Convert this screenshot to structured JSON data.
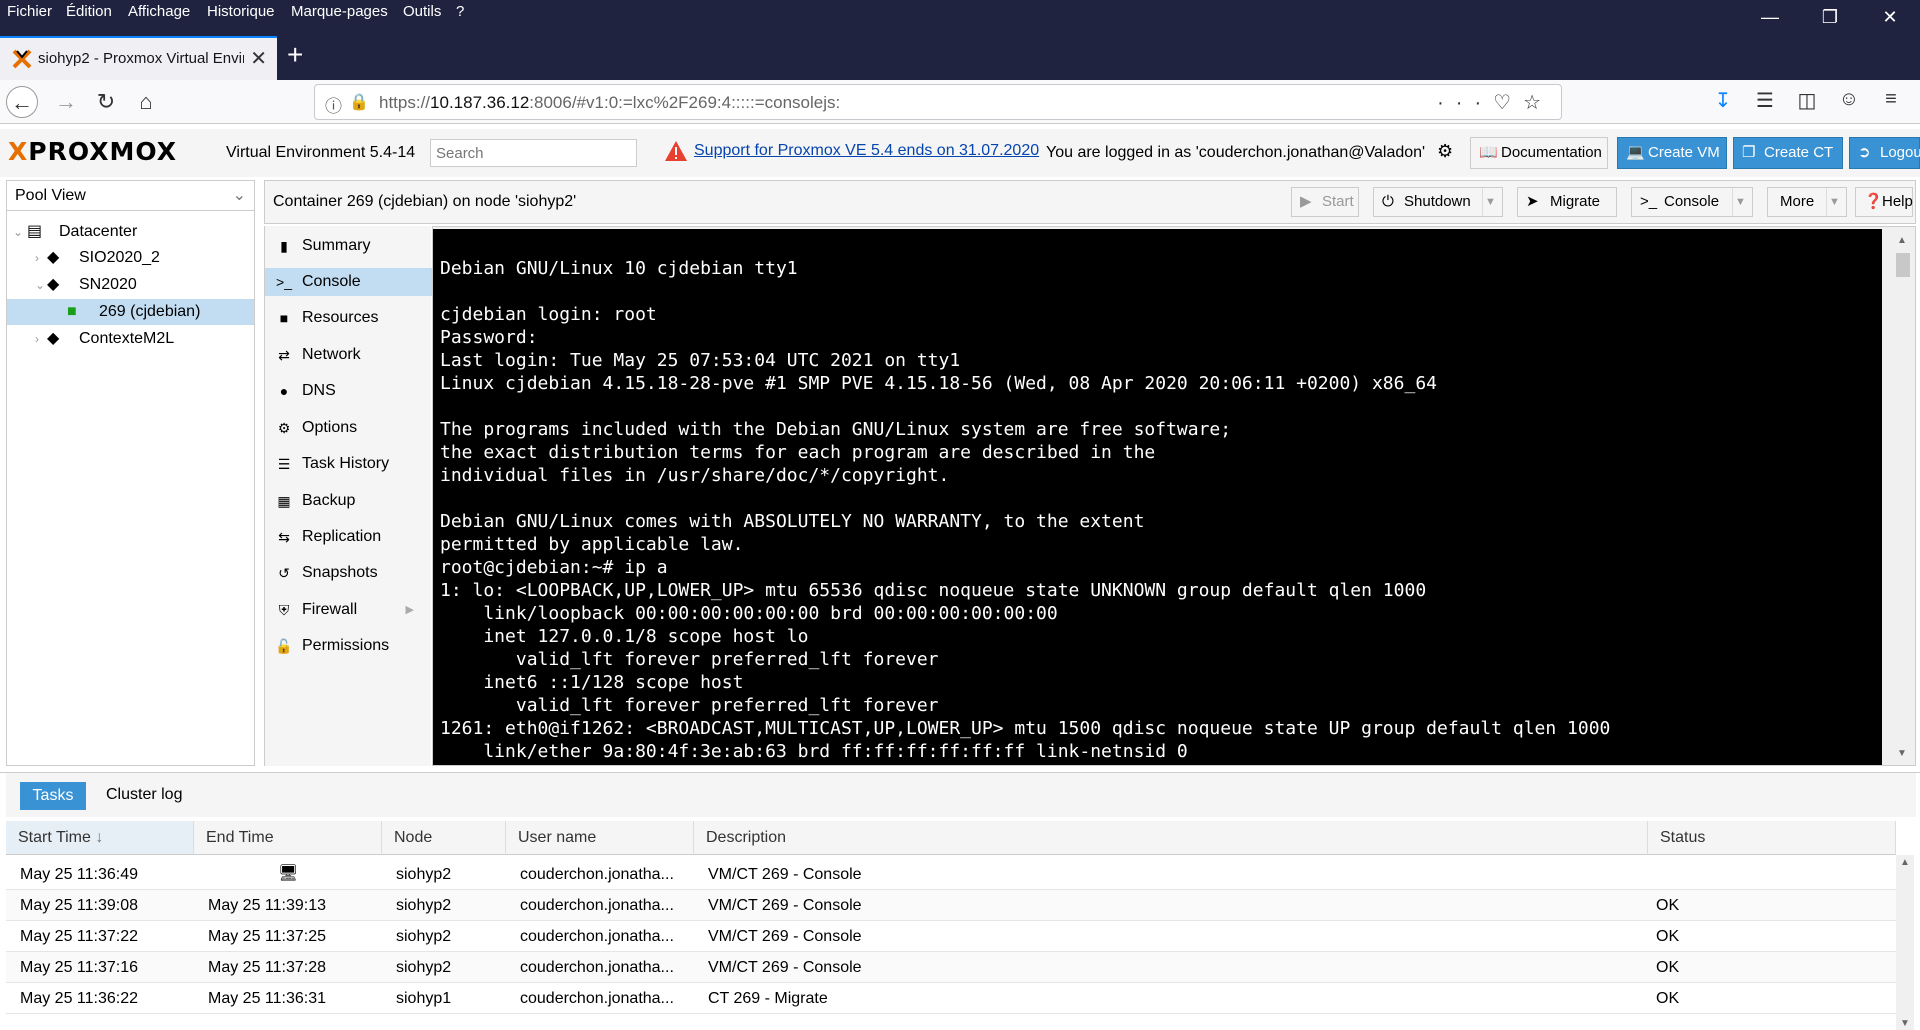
{
  "browser": {
    "menu": [
      "Fichier",
      "Édition",
      "Affichage",
      "Historique",
      "Marque-pages",
      "Outils",
      "?"
    ],
    "tab_title": "siohyp2 - Proxmox Virtual Envir",
    "url_prefix": "https://",
    "url_host": "10.187.36.12",
    "url_rest": ":8006/#v1:0:=lxc%2F269:4:::::=consolejs:"
  },
  "pve": {
    "logo": "PROXMOX",
    "version": "Virtual Environment 5.4-14",
    "search_placeholder": "Search",
    "support_link": "Support for Proxmox VE 5.4 ends on 31.07.2020",
    "logged_in": "You are logged in as 'couderchon.jonathan@Valadon'",
    "buttons": {
      "documentation": "Documentation",
      "create_vm": "Create VM",
      "create_ct": "Create CT",
      "logout": "Logou"
    }
  },
  "tree": {
    "view": "Pool View",
    "datacenter": "Datacenter",
    "nodes": [
      "SIO2020_2",
      "SN2020",
      "269 (cjdebian)",
      "ContexteM2L"
    ]
  },
  "content": {
    "title": "Container 269 (cjdebian) on node 'siohyp2'",
    "toolbar": {
      "start": "Start",
      "shutdown": "Shutdown",
      "migrate": "Migrate",
      "console": "Console",
      "more": "More",
      "help": "Help"
    },
    "subnav": [
      "Summary",
      "Console",
      "Resources",
      "Network",
      "DNS",
      "Options",
      "Task History",
      "Backup",
      "Replication",
      "Snapshots",
      "Firewall",
      "Permissions"
    ],
    "selected_subnav": "Console"
  },
  "terminal": {
    "text": "Debian GNU/Linux 10 cjdebian tty1\n\ncjdebian login: root\nPassword:\nLast login: Tue May 25 07:53:04 UTC 2021 on tty1\nLinux cjdebian 4.15.18-28-pve #1 SMP PVE 4.15.18-56 (Wed, 08 Apr 2020 20:06:11 +0200) x86_64\n\nThe programs included with the Debian GNU/Linux system are free software;\nthe exact distribution terms for each program are described in the\nindividual files in /usr/share/doc/*/copyright.\n\nDebian GNU/Linux comes with ABSOLUTELY NO WARRANTY, to the extent\npermitted by applicable law.\nroot@cjdebian:~# ip a\n1: lo: <LOOPBACK,UP,LOWER_UP> mtu 65536 qdisc noqueue state UNKNOWN group default qlen 1000\n    link/loopback 00:00:00:00:00:00 brd 00:00:00:00:00:00\n    inet 127.0.0.1/8 scope host lo\n       valid_lft forever preferred_lft forever\n    inet6 ::1/128 scope host\n       valid_lft forever preferred_lft forever\n1261: eth0@if1262: <BROADCAST,MULTICAST,UP,LOWER_UP> mtu 1500 qdisc noqueue state UP group default qlen 1000\n    link/ether 9a:80:4f:3e:ab:63 brd ff:ff:ff:ff:ff:ff link-netnsid 0"
  },
  "tasks": {
    "tab_tasks": "Tasks",
    "tab_cluster": "Cluster log",
    "columns": [
      "Start Time",
      "End Time",
      "Node",
      "User name",
      "Description",
      "Status"
    ],
    "rows": [
      {
        "start": "May 25 11:36:49",
        "end": "",
        "node": "siohyp2",
        "user": "couderchon.jonatha...",
        "desc": "VM/CT 269 - Console",
        "status": ""
      },
      {
        "start": "May 25 11:39:08",
        "end": "May 25 11:39:13",
        "node": "siohyp2",
        "user": "couderchon.jonatha...",
        "desc": "VM/CT 269 - Console",
        "status": "OK"
      },
      {
        "start": "May 25 11:37:22",
        "end": "May 25 11:37:25",
        "node": "siohyp2",
        "user": "couderchon.jonatha...",
        "desc": "VM/CT 269 - Console",
        "status": "OK"
      },
      {
        "start": "May 25 11:37:16",
        "end": "May 25 11:37:28",
        "node": "siohyp2",
        "user": "couderchon.jonatha...",
        "desc": "VM/CT 269 - Console",
        "status": "OK"
      },
      {
        "start": "May 25 11:36:22",
        "end": "May 25 11:36:31",
        "node": "siohyp1",
        "user": "couderchon.jonatha...",
        "desc": "CT 269 - Migrate",
        "status": "OK"
      }
    ]
  },
  "colors": {
    "chrome_dark": "#202340",
    "accent_blue": "#3892d4",
    "selection": "#c2ddf2",
    "proxmox_orange": "#e57000"
  }
}
